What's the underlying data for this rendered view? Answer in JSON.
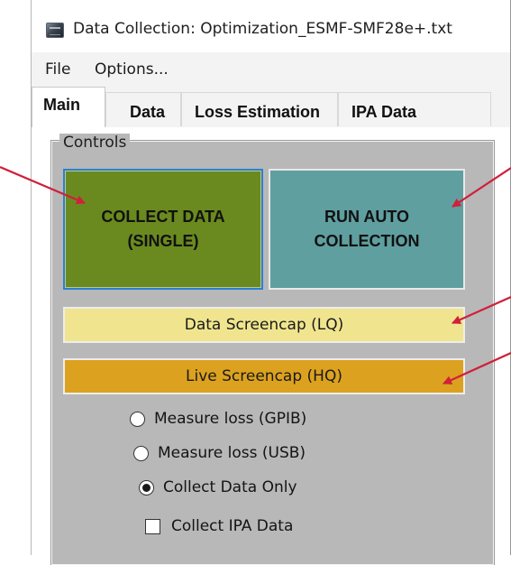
{
  "window": {
    "title": "Data Collection: Optimization_ESMF-SMF28e+.txt",
    "icon": "app-window-icon"
  },
  "menu": {
    "items": [
      {
        "label": "File"
      },
      {
        "label": "Options..."
      }
    ]
  },
  "tabs": [
    {
      "label": "Main",
      "active": true
    },
    {
      "label": "Data",
      "active": false
    },
    {
      "label": "Loss Estimation",
      "active": false
    },
    {
      "label": "IPA Data",
      "active": false
    }
  ],
  "controls": {
    "group_label": "Controls",
    "collect_single_label": "COLLECT DATA\n(SINGLE)",
    "auto_collection_label": "RUN AUTO\nCOLLECTION",
    "data_screencap_label": "Data Screencap (LQ)",
    "live_screencap_label": "Live Screencap (HQ)",
    "options": [
      {
        "label": "Measure loss (GPIB)",
        "checked": false
      },
      {
        "label": "Measure loss (USB)",
        "checked": false
      },
      {
        "label": "Collect Data Only",
        "checked": true
      }
    ],
    "collect_ipa_label": "Collect IPA Data",
    "collect_ipa_checked": false
  },
  "colors": {
    "collect_single": "#6a8a1f",
    "auto_collection": "#5f9fa0",
    "data_screencap": "#f0e58e",
    "live_screencap": "#dca21f",
    "annotation_arrow": "#d0203a"
  }
}
